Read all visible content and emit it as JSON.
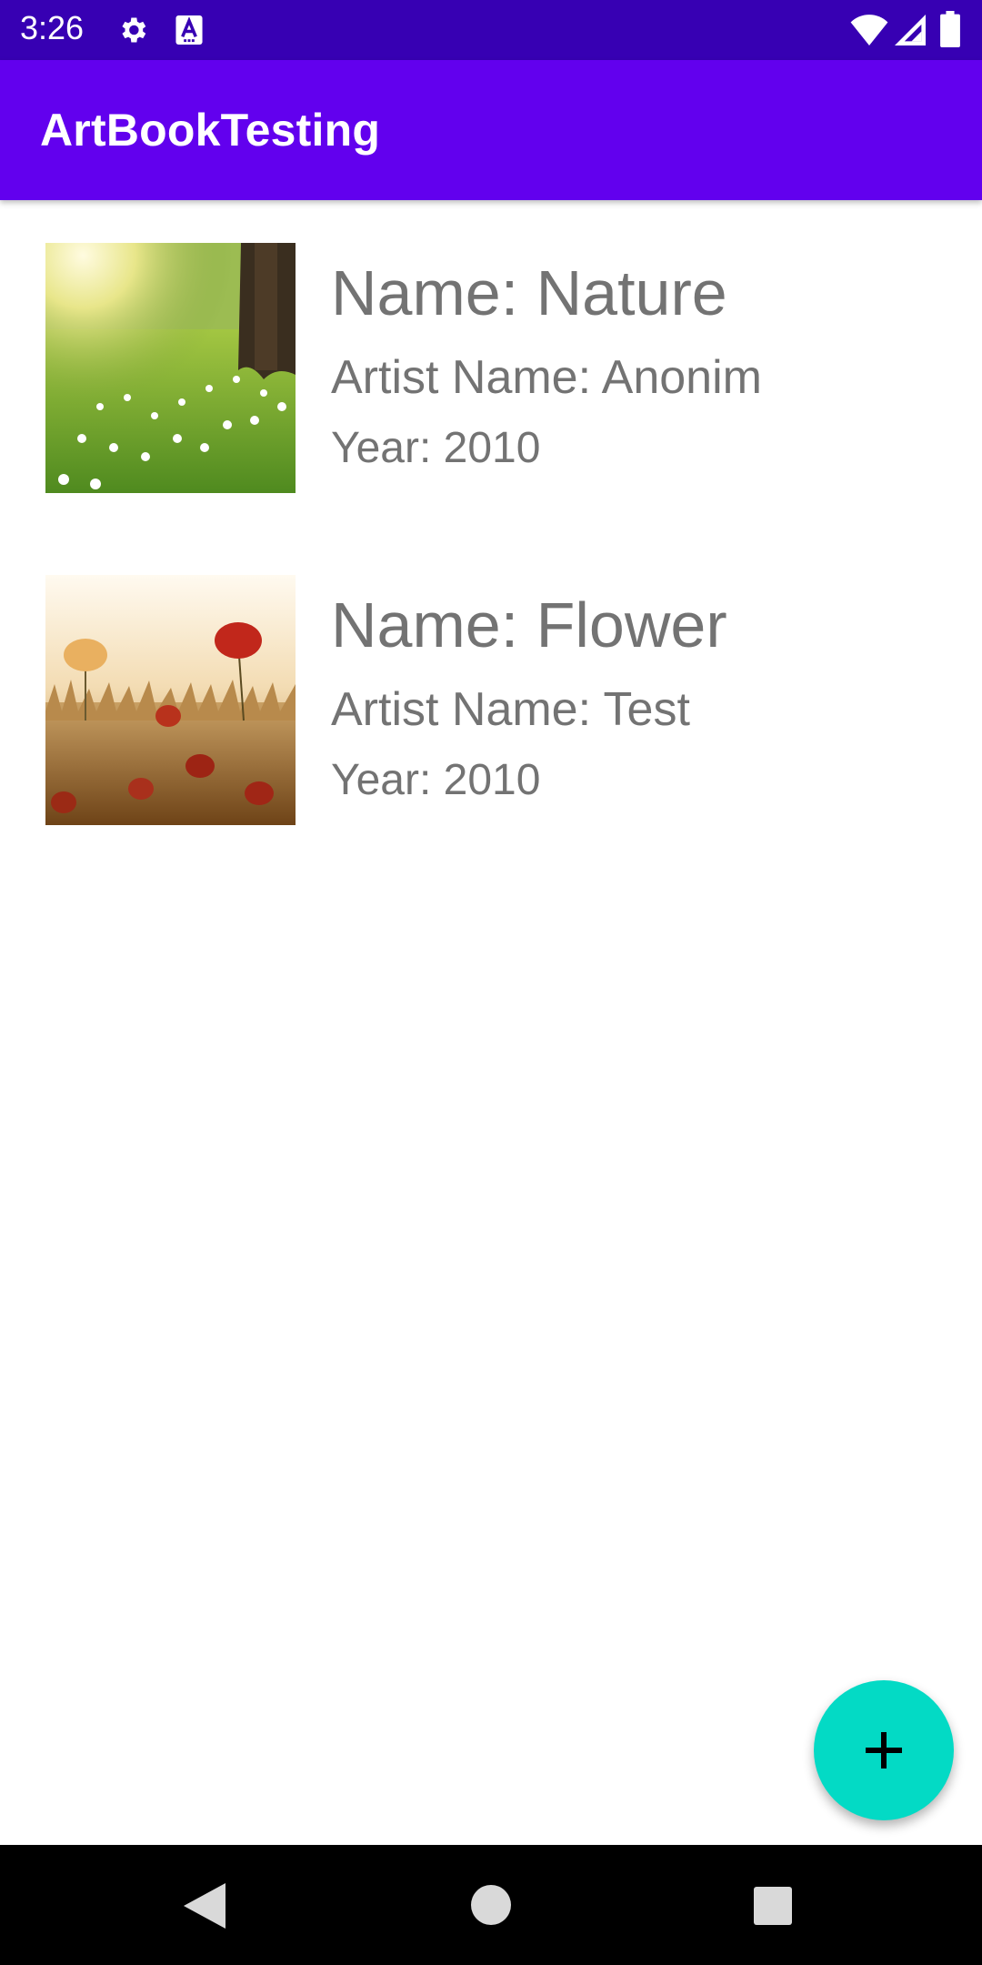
{
  "status_bar": {
    "time": "3:26",
    "icons": [
      "gear-icon",
      "a-badge-icon",
      "wifi-icon",
      "signal-icon",
      "battery-icon"
    ]
  },
  "app_bar": {
    "title": "ArtBookTesting",
    "color": "#6200ee"
  },
  "arts": [
    {
      "name": "Name: Nature",
      "artist": "Artist Name: Anonim",
      "year": "Year: 2010",
      "image": "nature-photo"
    },
    {
      "name": "Name: Flower",
      "artist": "Artist Name: Test",
      "year": "Year: 2010",
      "image": "poppy-field-photo"
    }
  ],
  "fab": {
    "icon": "plus-icon",
    "color": "#03dac5"
  },
  "nav_bar": {
    "icons": [
      "back-icon",
      "home-icon",
      "recents-icon"
    ]
  }
}
